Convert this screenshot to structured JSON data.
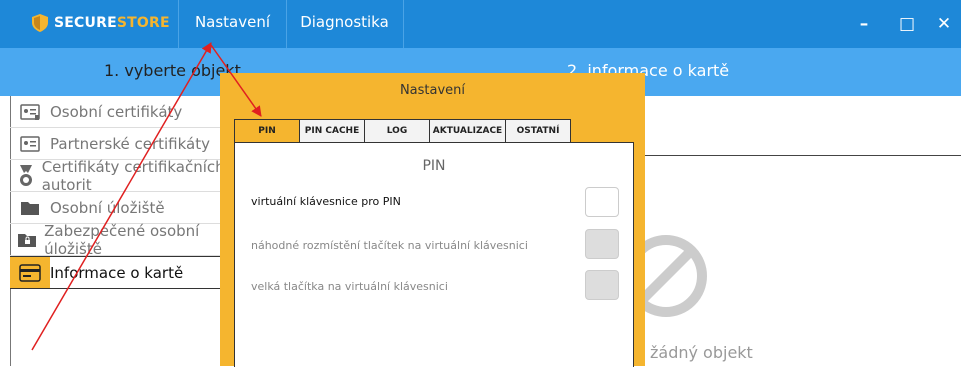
{
  "app": {
    "brand_part1": "SECURE",
    "brand_part2": "STORE"
  },
  "menu": {
    "settings": "Nastavení",
    "diagnostics": "Diagnostika"
  },
  "window_controls": {
    "minimize": "–",
    "maximize": "□",
    "close": "✕"
  },
  "steps": {
    "step1": "1. vyberte objekt",
    "step2": "2. informace o kartě"
  },
  "sidebar": {
    "items": [
      {
        "label": "Osobní certifikáty",
        "icon": "id-card-icon"
      },
      {
        "label": "Partnerské certifikáty",
        "icon": "id-card-lines-icon"
      },
      {
        "label": "Certifikáty certifikačních autorit",
        "icon": "medal-icon"
      },
      {
        "label": "Osobní úložiště",
        "icon": "folder-icon"
      },
      {
        "label": "Zabezpečené osobní úložiště",
        "icon": "locked-folder-icon"
      },
      {
        "label": "Informace o kartě",
        "icon": "smart-card-icon",
        "active": true
      }
    ]
  },
  "no_object": {
    "label": "žádný objekt",
    "icon": "forbidden-icon"
  },
  "dialog": {
    "title": "Nastavení",
    "tabs": [
      "PIN",
      "PIN CACHE",
      "LOG",
      "AKTUALIZACE",
      "OSTATNÍ"
    ],
    "active_tab": "PIN",
    "panel_title": "PIN",
    "options": [
      {
        "label": "virtuální klávesnice pro PIN",
        "enabled": true,
        "checked": false
      },
      {
        "label": "náhodné rozmístění tlačítek na virtuální klávesnici",
        "enabled": false,
        "checked": false
      },
      {
        "label": "velká tlačítka na virtuální klávesnici",
        "enabled": false,
        "checked": false
      }
    ]
  },
  "colors": {
    "titlebar": "#1e88d8",
    "stepbar": "#4aa8f0",
    "accent": "#f5b52f",
    "annotation": "#e02020"
  }
}
